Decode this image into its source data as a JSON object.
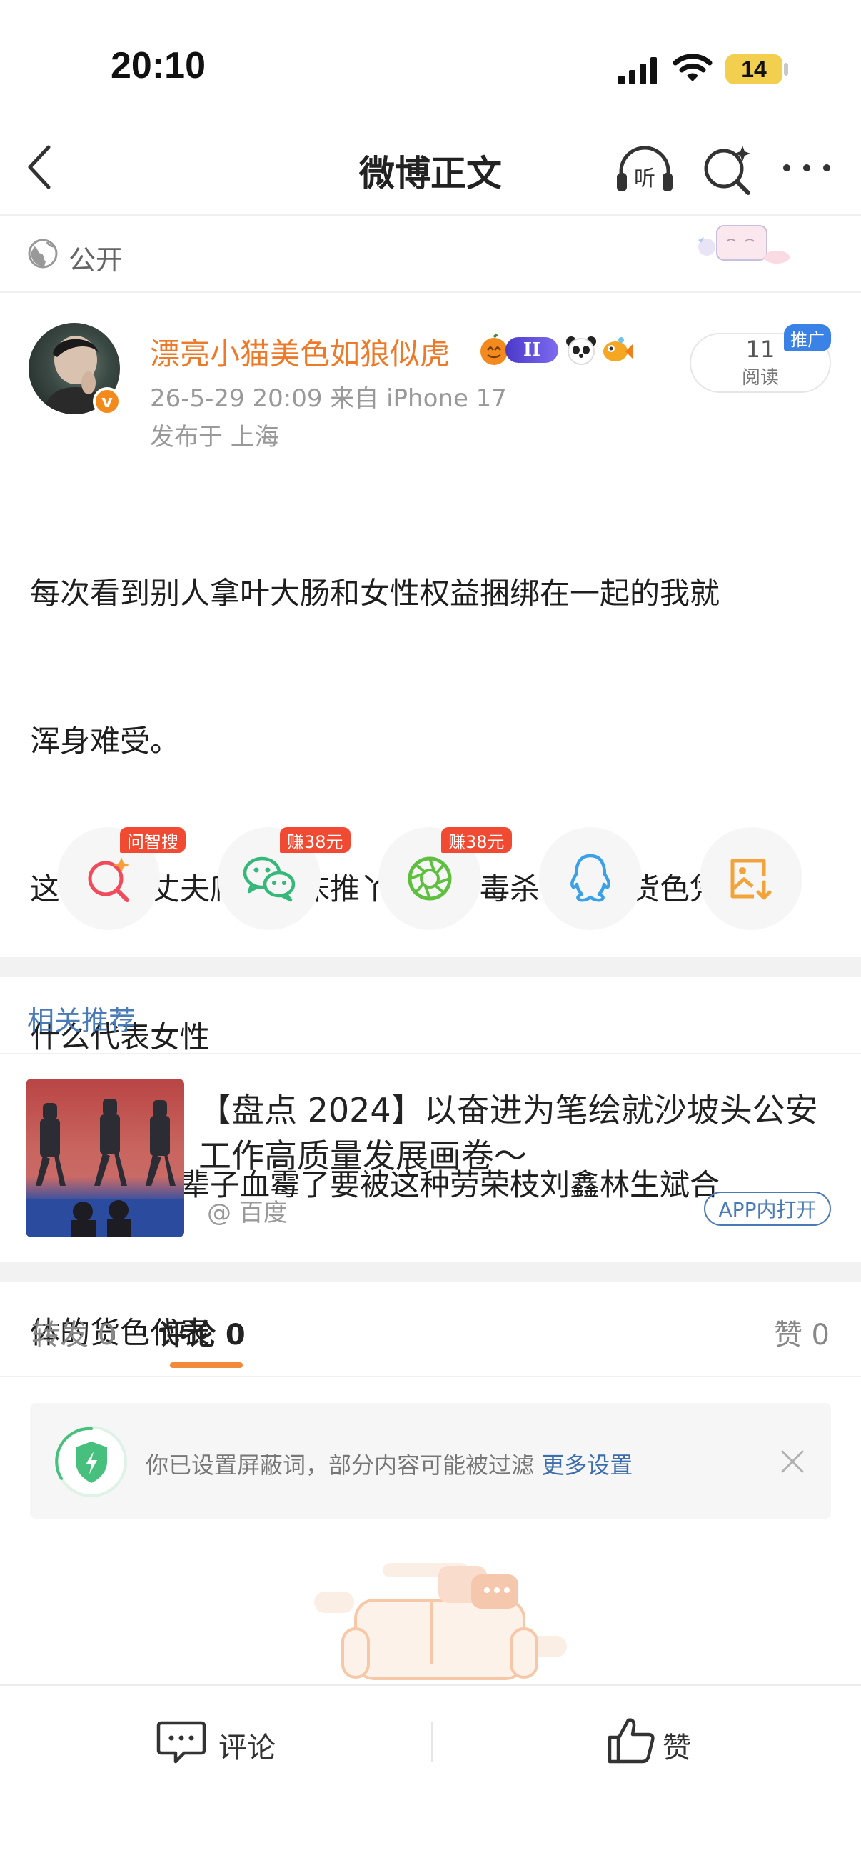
{
  "status_bar": {
    "time": "20:10",
    "battery": "14"
  },
  "nav": {
    "title": "微博正文"
  },
  "visibility": {
    "label": "公开"
  },
  "author": {
    "name": "漂亮小猫美色如狼似虎",
    "level_badge": "II",
    "verified_badge": "v",
    "meta": "26-5-29 20:09  来自 iPhone 17",
    "location": "发布于 上海"
  },
  "read_box": {
    "count": "11",
    "label": "阅读",
    "promo_tag": "推广"
  },
  "post": {
    "lines": [
      "每次看到别人拿叶大肠和女性权益捆绑在一起的我就",
      "浑身难受。",
      "这种出卖丈夫爬妹夫床推丫鬟挡刀毒杀祖母的货色凭",
      "什么代表女性",
      "女性倒了八辈子血霉了要被这种劳荣枝刘鑫林生斌合",
      "体的货色代表"
    ]
  },
  "share": {
    "items": [
      {
        "icon": "zhisou-search-icon",
        "tag": "问智搜"
      },
      {
        "icon": "wechat-icon",
        "tag": "赚38元"
      },
      {
        "icon": "moments-icon",
        "tag": "赚38元"
      },
      {
        "icon": "qq-icon",
        "tag": ""
      },
      {
        "icon": "save-image-icon",
        "tag": ""
      }
    ]
  },
  "related": {
    "section_title": "相关推荐",
    "item": {
      "title": "【盘点 2024】以奋进为笔绘就沙坡头公安工作高质量发展画卷～",
      "source": "@ 百度",
      "open_label": "APP内打开"
    }
  },
  "tabs": {
    "repost": "转发 0",
    "comment": "评论 0",
    "like": "赞 0"
  },
  "notice": {
    "text": "你已设置屏蔽词，部分内容可能被过滤",
    "link": "更多设置"
  },
  "bottom_bar": {
    "comment_label": "评论",
    "like_label": "赞"
  },
  "colors": {
    "accent_orange": "#ed7a29",
    "link_blue": "#4a7bb7",
    "tag_red": "#f04b32"
  }
}
